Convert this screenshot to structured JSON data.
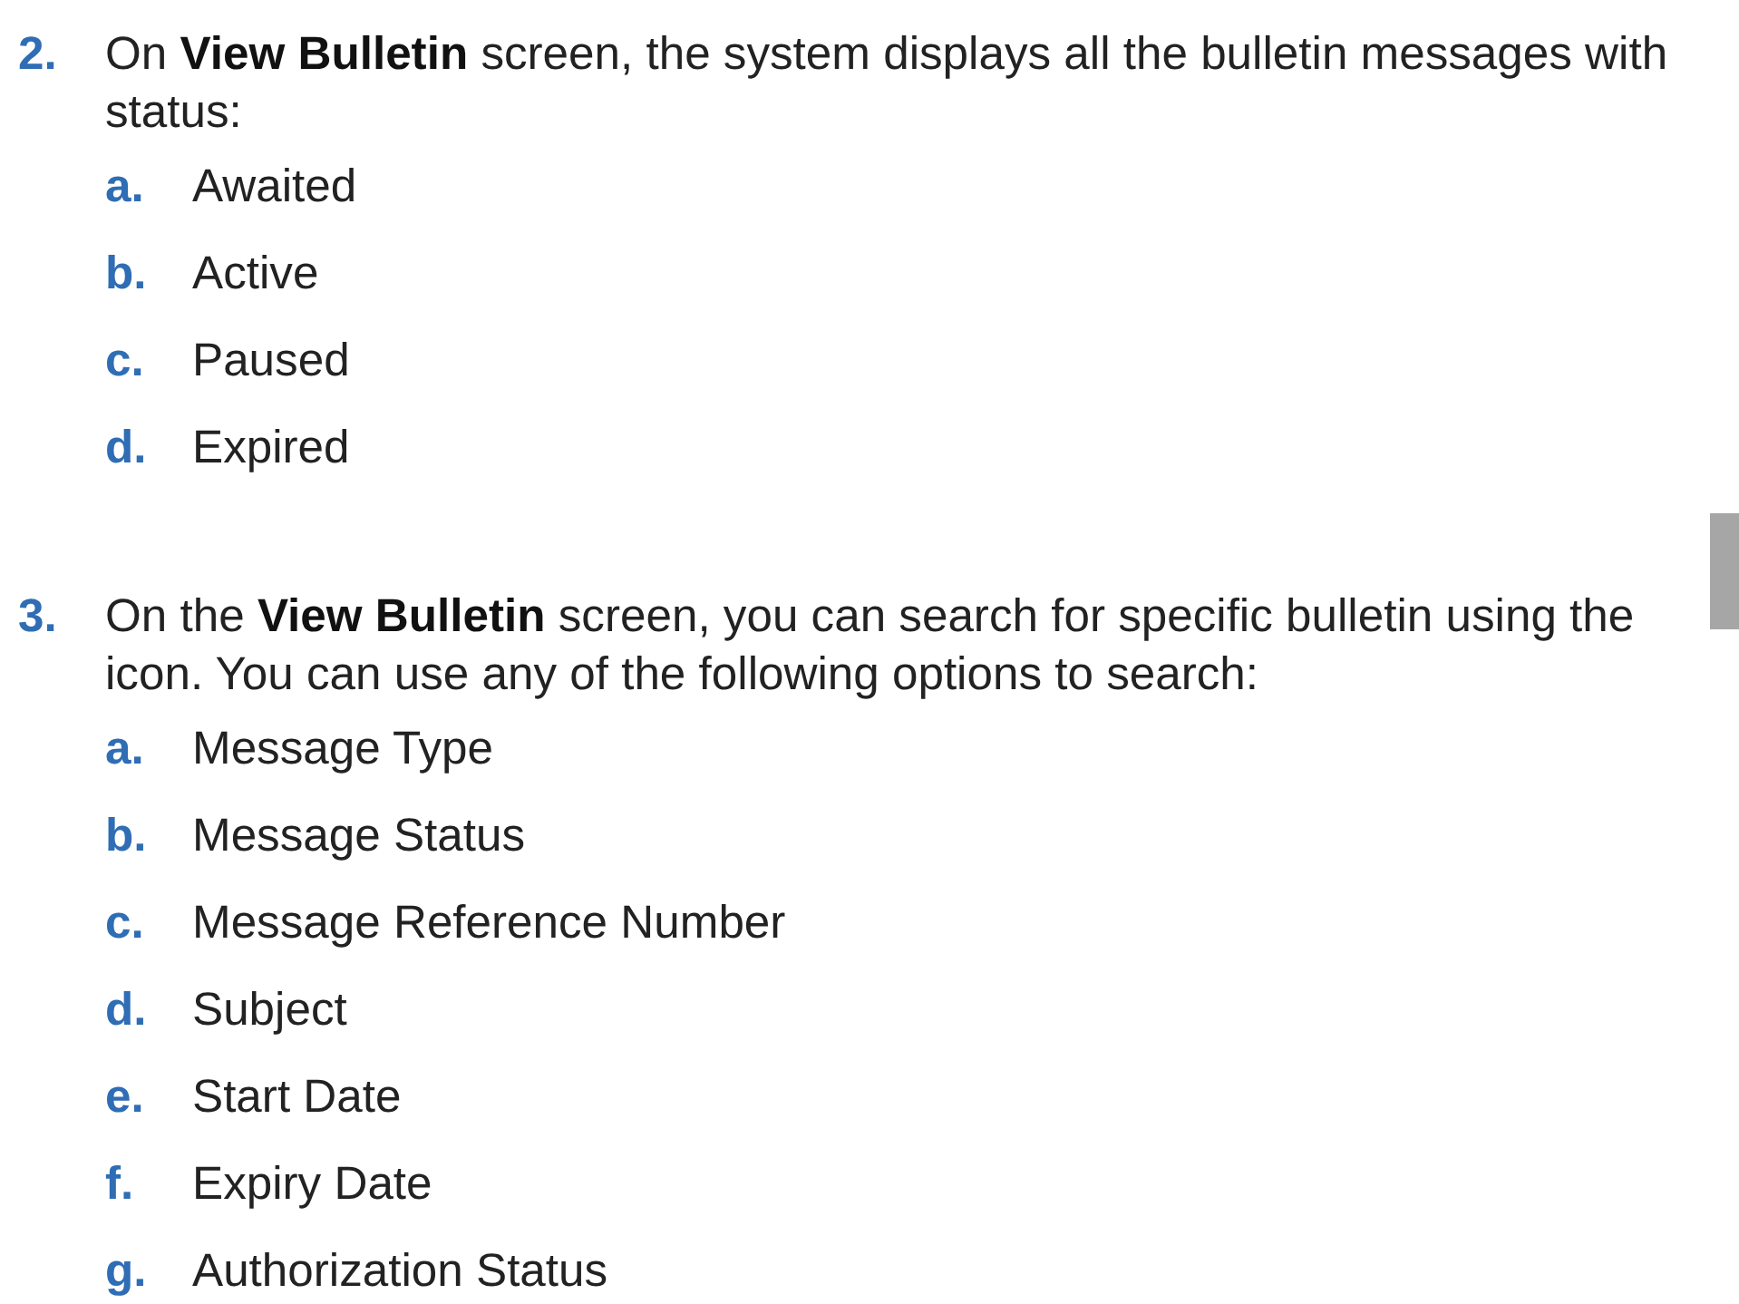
{
  "steps": [
    {
      "number": "2.",
      "text": "On **View Bulletin** screen, the system displays all the bulletin messages with status:",
      "inline_icon": false,
      "items": [
        {
          "letter": "a.",
          "text": "Awaited"
        },
        {
          "letter": "b.",
          "text": "Active"
        },
        {
          "letter": "c.",
          "text": "Paused"
        },
        {
          "letter": "d.",
          "text": "Expired"
        }
      ]
    },
    {
      "number": "3.",
      "text": "On the **View Bulletin** screen, you can search for specific bulletin using the icon. You can use any of the following options to search:",
      "inline_icon": true,
      "items": [
        {
          "letter": "a.",
          "text": "Message Type"
        },
        {
          "letter": "b.",
          "text": "Message Status"
        },
        {
          "letter": "c.",
          "text": "Message Reference Number"
        },
        {
          "letter": "d.",
          "text": "Subject"
        },
        {
          "letter": "e.",
          "text": "Start Date"
        },
        {
          "letter": "f.",
          "text": "Expiry Date"
        },
        {
          "letter": "g.",
          "text": "Authorization Status"
        }
      ]
    }
  ]
}
